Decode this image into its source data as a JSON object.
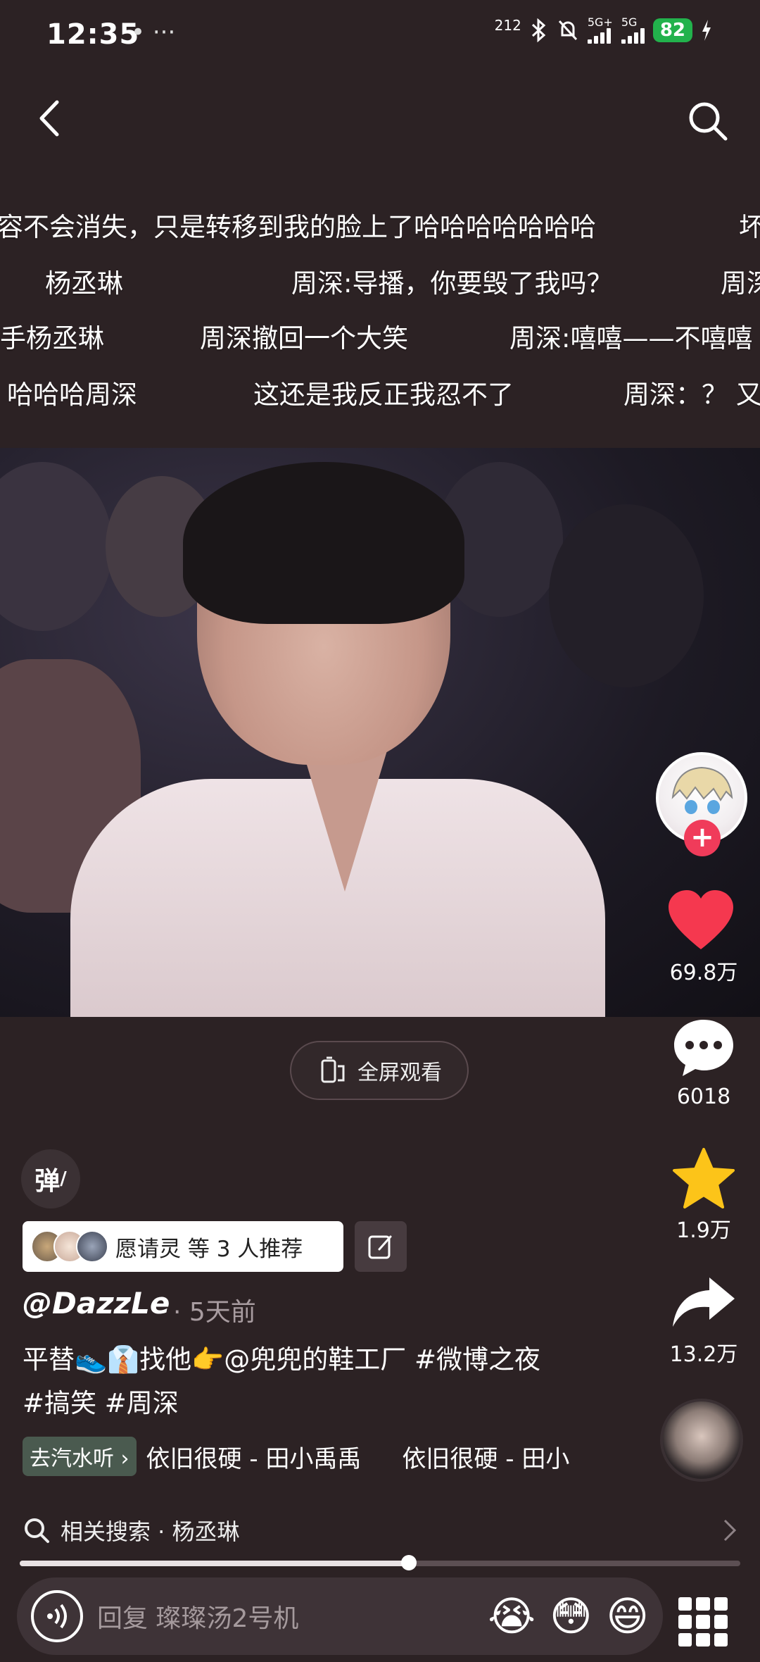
{
  "status_bar": {
    "time": "12:35",
    "dots": "• ···",
    "speed": "212",
    "net1": "5G+",
    "net2": "5G",
    "battery": "82"
  },
  "danmaku": [
    "容不会消失，只是转移到我的脸上了哈哈哈哈哈哈哈",
    "坏",
    "杨丞琳",
    "周深:导播，你要毁了我吗？",
    "周深",
    "手杨丞琳",
    "周深撤回一个大笑",
    "周深:嘻嘻——不嘻嘻",
    "哈哈哈周深",
    "这还是我反正我忍不了",
    "周深：？ 又"
  ],
  "video": {
    "fullscreen_label": "全屏观看"
  },
  "rail": {
    "like_count": "69.8万",
    "comment_count": "6018",
    "favorite_count": "1.9万",
    "share_count": "13.2万"
  },
  "danmu_toggle_label": "弹",
  "recommend": {
    "text": "愿请灵 等 3 人推荐"
  },
  "post": {
    "author": "@DazzLe",
    "time_ago": "· 5天前",
    "caption_line1": "平替👟👔找他👉@兜兜的鞋工厂 #微博之夜",
    "caption_line2": "#搞笑 #周深"
  },
  "music": {
    "button": "去汽水听 ›",
    "track1": "依旧很硬 - 田小禹禹",
    "track2": "依旧很硬 - 田小"
  },
  "related": {
    "text": "相关搜索 · 杨丞琳"
  },
  "progress": 0.54,
  "reply": {
    "placeholder": "回复 璨璨汤2号机",
    "emojis": [
      "😭",
      "😳",
      "😄"
    ]
  },
  "colors": {
    "background": "#2c2224",
    "like": "#f5384f",
    "favorite": "#fcc419",
    "battery": "#22b24c"
  }
}
